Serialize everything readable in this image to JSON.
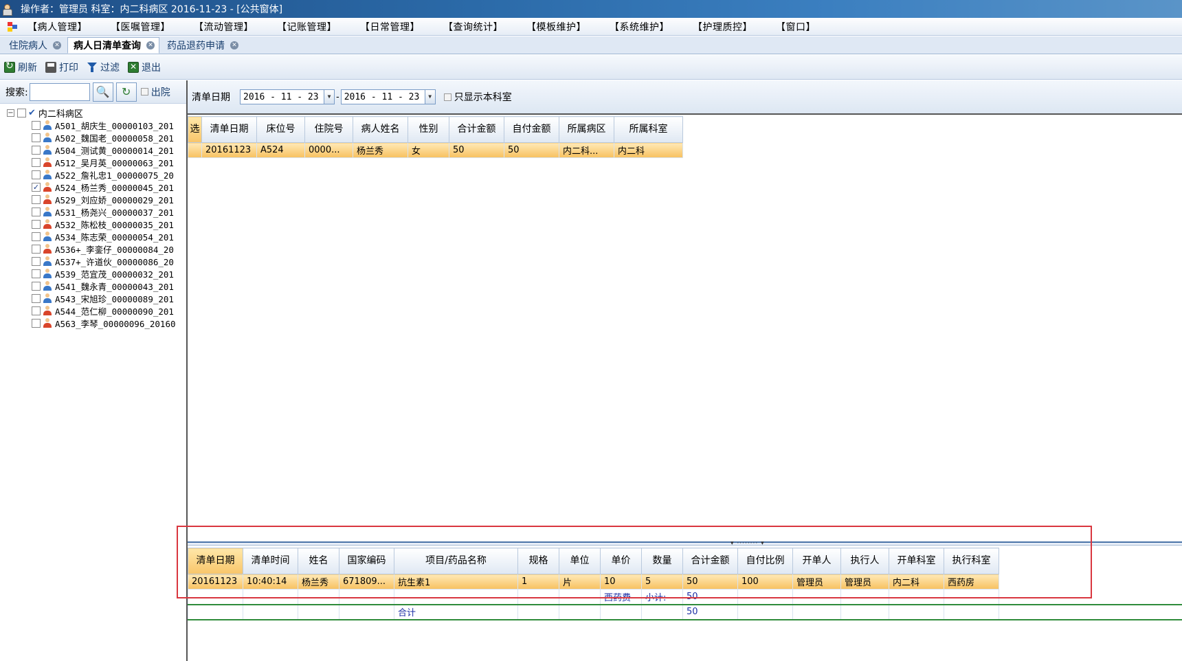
{
  "window": {
    "title": "操作者：管理员  科室：内二科病区  2016-11-23 - [公共窗体]"
  },
  "menu": [
    "【病人管理】",
    "【医嘱管理】",
    "【流动管理】",
    "【记账管理】",
    "【日常管理】",
    "【查询统计】",
    "【模板维护】",
    "【系统维护】",
    "【护理质控】",
    "【窗口】"
  ],
  "tabs": [
    {
      "label": "住院病人",
      "active": false
    },
    {
      "label": "病人日清单查询",
      "active": true
    },
    {
      "label": "药品退药申请",
      "active": false
    }
  ],
  "toolbar": {
    "refresh": "刷新",
    "print": "打印",
    "filter": "过滤",
    "exit": "退出"
  },
  "search": {
    "label": "搜索:",
    "value": "",
    "discharged_label": "出院"
  },
  "tree": {
    "root": "内二科病区",
    "patients": [
      {
        "label": "A501_胡庆生_00000103_201",
        "gender": "male",
        "checked": false
      },
      {
        "label": "A502_魏国老_00000058_201",
        "gender": "male",
        "checked": false
      },
      {
        "label": "A504_测试黄_00000014_201",
        "gender": "male",
        "checked": false
      },
      {
        "label": "A512_吴月英_00000063_201",
        "gender": "female",
        "checked": false
      },
      {
        "label": "A522_詹礼忠1_00000075_20",
        "gender": "male",
        "checked": false
      },
      {
        "label": "A524_杨兰秀_00000045_201",
        "gender": "female",
        "checked": true
      },
      {
        "label": "A529_刘应娇_00000029_201",
        "gender": "female",
        "checked": false
      },
      {
        "label": "A531_杨尧兴_00000037_201",
        "gender": "male",
        "checked": false
      },
      {
        "label": "A532_陈松枝_00000035_201",
        "gender": "female",
        "checked": false
      },
      {
        "label": "A534_陈志荣_00000054_201",
        "gender": "male",
        "checked": false
      },
      {
        "label": "A536+_李銮仔_00000084_20",
        "gender": "female",
        "checked": false
      },
      {
        "label": "A537+_许道伙_00000086_20",
        "gender": "male",
        "checked": false
      },
      {
        "label": "A539_范宜茂_00000032_201",
        "gender": "male",
        "checked": false
      },
      {
        "label": "A541_魏永青_00000043_201",
        "gender": "male",
        "checked": false
      },
      {
        "label": "A543_宋旭珍_00000089_201",
        "gender": "male",
        "checked": false
      },
      {
        "label": "A544_范仁柳_00000090_201",
        "gender": "female",
        "checked": false
      },
      {
        "label": "A563_李琴_00000096_20160",
        "gender": "female",
        "checked": false
      }
    ]
  },
  "filter": {
    "label": "清单日期",
    "date_from": "2016 - 11 - 23",
    "date_to": "2016 - 11 - 23",
    "separator": "-",
    "only_dept_label": "只显示本科室"
  },
  "upper_grid": {
    "columns": [
      "选",
      "清单日期",
      "床位号",
      "住院号",
      "病人姓名",
      "性别",
      "合计金额",
      "自付金额",
      "所属病区",
      "所属科室"
    ],
    "rows": [
      [
        "",
        "20161123",
        "A524",
        "0000...",
        "杨兰秀",
        "女",
        "50",
        "50",
        "内二科...",
        "内二科"
      ]
    ]
  },
  "lower_grid": {
    "columns": [
      "清单日期",
      "清单时间",
      "姓名",
      "国家编码",
      "项目/药品名称",
      "规格",
      "单位",
      "单价",
      "数量",
      "合计金额",
      "自付比例",
      "开单人",
      "执行人",
      "开单科室",
      "执行科室"
    ],
    "rows": [
      [
        "20161123",
        "10:40:14",
        "杨兰秀",
        "671809...",
        "抗生素1",
        "1",
        "片",
        "10",
        "5",
        "50",
        "100",
        "管理员",
        "管理员",
        "内二科",
        "西药房"
      ]
    ],
    "subtotal": {
      "category": "西药费",
      "label": "小计:",
      "amount": "50"
    },
    "total": {
      "label": "合计",
      "amount": "50"
    }
  }
}
